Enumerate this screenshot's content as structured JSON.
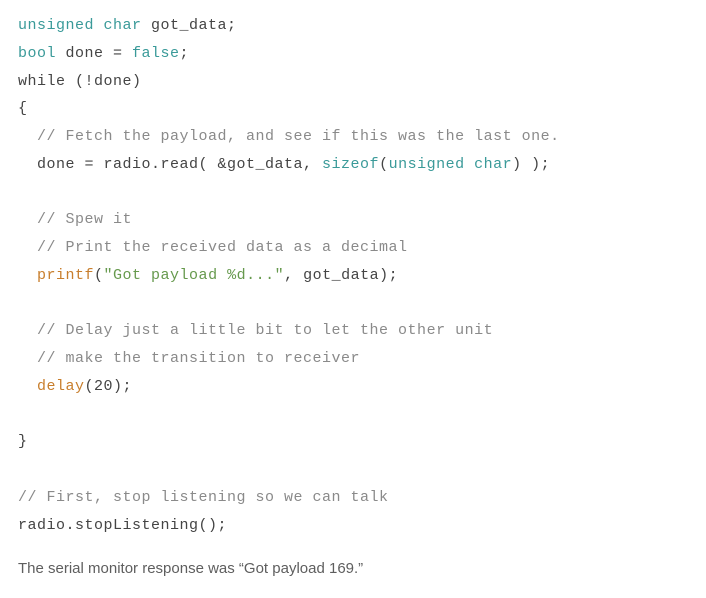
{
  "code": {
    "line1_type": "unsigned char",
    "line1_var": " got_data;",
    "line2_bool": "bool",
    "line2_mid": " done = ",
    "line2_val": "false",
    "line2_end": ";",
    "line3": "while (!done)",
    "line4": "{",
    "line5_comment": "  // Fetch the payload, and see if this was the last one.",
    "line6_a": "  done = radio.read( &got_data, ",
    "line6_sizeof": "sizeof",
    "line6_b": "(",
    "line6_type": "unsigned char",
    "line6_c": ") );",
    "line8_comment": "  // Spew it",
    "line9_comment": "  // Print the received data as a decimal",
    "line10_indent": "  ",
    "line10_printf": "printf",
    "line10_paren": "(",
    "line10_str": "\"Got payload %d...\"",
    "line10_end": ", got_data);",
    "line12_comment": "  // Delay just a little bit to let the other unit",
    "line13_comment": "  // make the transition to receiver",
    "line14_indent": "  ",
    "line14_delay": "delay",
    "line14_end": "(20);",
    "line16": "}",
    "line18_comment": "// First, stop listening so we can talk",
    "line19": "radio.stopListening();"
  },
  "footer": "The serial monitor response was “Got payload 169.”"
}
